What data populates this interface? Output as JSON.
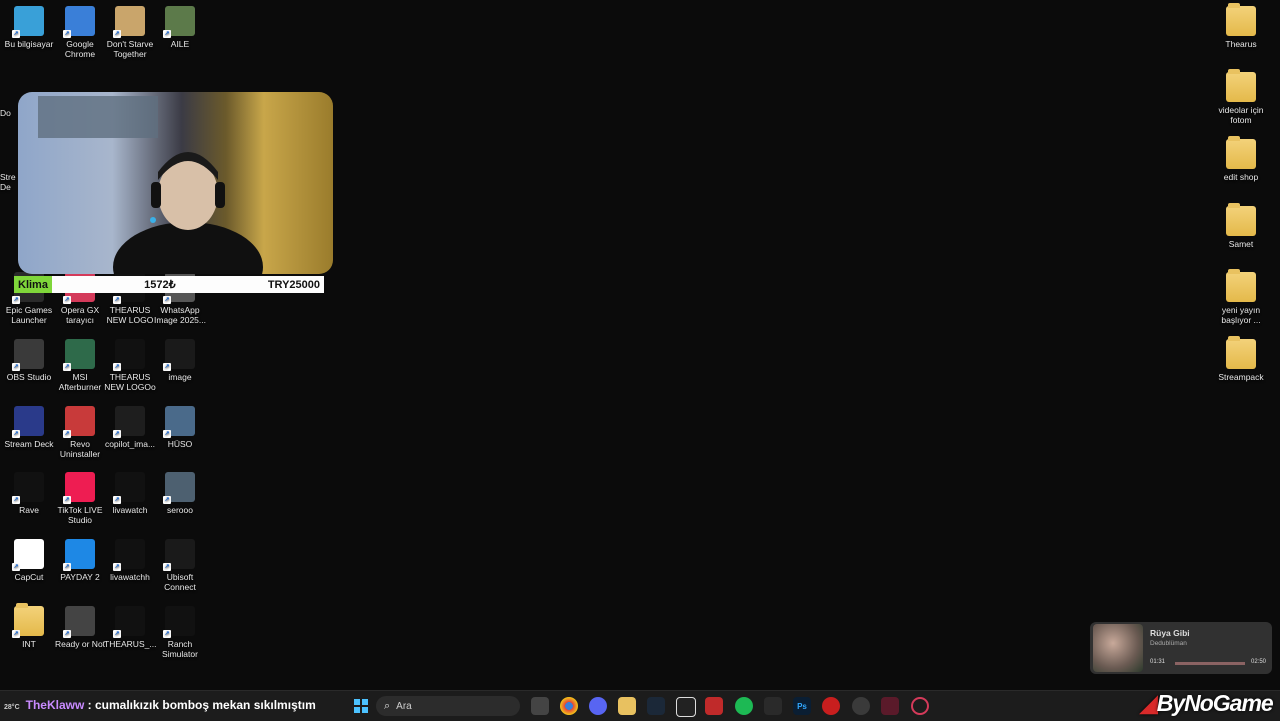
{
  "desktop_left": [
    {
      "name": "bu-bilgisayar",
      "label": "Bu bilgisayar",
      "icon": "monitor-icon",
      "color": "#39a0d8"
    },
    {
      "name": "google-chrome",
      "label": "Google Chrome",
      "icon": "chrome-icon",
      "color": "#3a7fd8"
    },
    {
      "name": "dont-starve",
      "label": "Don't Starve Together",
      "icon": "game-icon",
      "color": "#c9a56b"
    },
    {
      "name": "aile",
      "label": "AILE",
      "icon": "image-icon",
      "color": "#5c7a4a"
    },
    {
      "name": "epic-games",
      "label": "Epic Games Launcher",
      "icon": "epic-icon",
      "color": "#2a2a2a"
    },
    {
      "name": "opera-gx",
      "label": "Opera GX tarayıcı",
      "icon": "opera-icon",
      "color": "#d43a5a"
    },
    {
      "name": "thearus-logo",
      "label": "THEARUS NEW LOGO",
      "icon": "logo-icon",
      "color": "#111111"
    },
    {
      "name": "whatsapp-image",
      "label": "WhatsApp Image 2025...",
      "icon": "image-icon",
      "color": "#555555"
    },
    {
      "name": "obs-studio",
      "label": "OBS Studio",
      "icon": "obs-icon",
      "color": "#3a3a3a"
    },
    {
      "name": "msi-afterburner",
      "label": "MSI Afterburner",
      "icon": "afterburner-icon",
      "color": "#2e6a4a"
    },
    {
      "name": "thearus-logo-o",
      "label": "THEARUS NEW LOGOo",
      "icon": "logo-icon",
      "color": "#111111"
    },
    {
      "name": "image",
      "label": "image",
      "icon": "image-icon",
      "color": "#1a1a1a"
    },
    {
      "name": "stream-deck",
      "label": "Stream Deck",
      "icon": "streamdeck-icon",
      "color": "#2a3a8a"
    },
    {
      "name": "revo-uninstaller",
      "label": "Revo Uninstaller",
      "icon": "revo-icon",
      "color": "#c83a3a"
    },
    {
      "name": "copilot-image",
      "label": "copilot_ima...",
      "icon": "livawatch-icon",
      "color": "#1e1e1e"
    },
    {
      "name": "huso",
      "label": "HÜSO",
      "icon": "image-icon",
      "color": "#4a6a8a"
    },
    {
      "name": "rave",
      "label": "Rave",
      "icon": "rave-icon",
      "color": "#111111"
    },
    {
      "name": "tiktok-live",
      "label": "TikTok LIVE Studio",
      "icon": "tiktok-icon",
      "color": "#ee1d52"
    },
    {
      "name": "livawatch",
      "label": "livawatch",
      "icon": "livawatch-icon",
      "color": "#111111"
    },
    {
      "name": "serooo",
      "label": "serooo",
      "icon": "image-icon",
      "color": "#4d6070"
    },
    {
      "name": "capcut",
      "label": "CapCut",
      "icon": "capcut-icon",
      "color": "#ffffff"
    },
    {
      "name": "payday-2",
      "label": "PAYDAY 2",
      "icon": "payday-icon",
      "color": "#1e88e5"
    },
    {
      "name": "livawatchh",
      "label": "livawatchh",
      "icon": "livawatch-icon",
      "color": "#111111"
    },
    {
      "name": "ubisoft-connect",
      "label": "Ubisoft Connect",
      "icon": "ubisoft-icon",
      "color": "#1a1a1a"
    },
    {
      "name": "int",
      "label": "INT",
      "icon": "folder-icon",
      "color": "#e8c160"
    },
    {
      "name": "ready-or-not",
      "label": "Ready or Not",
      "icon": "readyornot-icon",
      "color": "#444444"
    },
    {
      "name": "thearus-short",
      "label": "THEARUS_...",
      "icon": "logo-icon",
      "color": "#111111"
    },
    {
      "name": "ranch-simulator",
      "label": "Ranch Simulator",
      "icon": "ranch-icon",
      "color": "#111111"
    }
  ],
  "desktop_right": [
    {
      "name": "thearus-folder",
      "label": "Thearus"
    },
    {
      "name": "videolar-folder",
      "label": "videolar için fotom"
    },
    {
      "name": "edit-shop-folder",
      "label": "edit shop"
    },
    {
      "name": "samet-folder",
      "label": "Samet"
    },
    {
      "name": "yeni-yayin-folder",
      "label": "yeni yayın başlıyor ..."
    },
    {
      "name": "streampack-folder",
      "label": "Streampack"
    }
  ],
  "partial_icons": {
    "a": "Do",
    "b": "Stre",
    "c": "De",
    "d": "S"
  },
  "price_bar": {
    "label": "Klima",
    "current": "1572₺",
    "goal": "TRY25000"
  },
  "ticker": {
    "user": "TheKlaww",
    "message": " : cumalıkızık bomboş mekan sıkılmıştım"
  },
  "weather": "28°C",
  "search": {
    "placeholder": "Ara"
  },
  "music": {
    "title": "Rüya Gibi",
    "artist": "Dedublüman",
    "elapsed": "01:31",
    "duration": "02:50"
  },
  "brand": {
    "name": "ByNoGame"
  }
}
